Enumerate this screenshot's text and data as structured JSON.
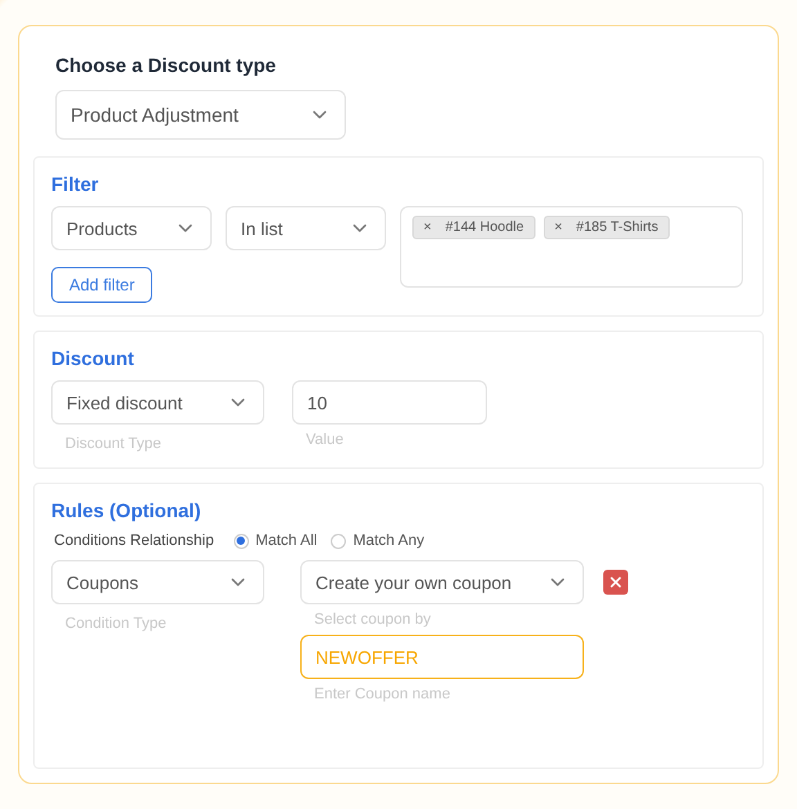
{
  "discount_type": {
    "label": "Choose a Discount type",
    "value": "Product Adjustment"
  },
  "filter": {
    "title": "Filter",
    "field": "Products",
    "operator": "In list",
    "tags": [
      {
        "remove": "×",
        "label": "#144 Hoodle"
      },
      {
        "remove": "×",
        "label": "#185 T-Shirts"
      }
    ],
    "add_button": "Add filter"
  },
  "discount": {
    "title": "Discount",
    "type": {
      "value": "Fixed discount",
      "caption": "Discount Type"
    },
    "amount": {
      "value": "10",
      "caption": "Value"
    }
  },
  "rules": {
    "title": "Rules (Optional)",
    "relationship_label": "Conditions Relationship",
    "options": [
      {
        "label": "Match All",
        "selected": true
      },
      {
        "label": "Match Any",
        "selected": false
      }
    ],
    "condition": {
      "value": "Coupons",
      "caption": "Condition Type"
    },
    "coupon_select": {
      "value": "Create your own coupon",
      "caption": "Select coupon by"
    },
    "coupon_name": {
      "value": "NEWOFFER",
      "caption": "Enter Coupon name"
    }
  }
}
